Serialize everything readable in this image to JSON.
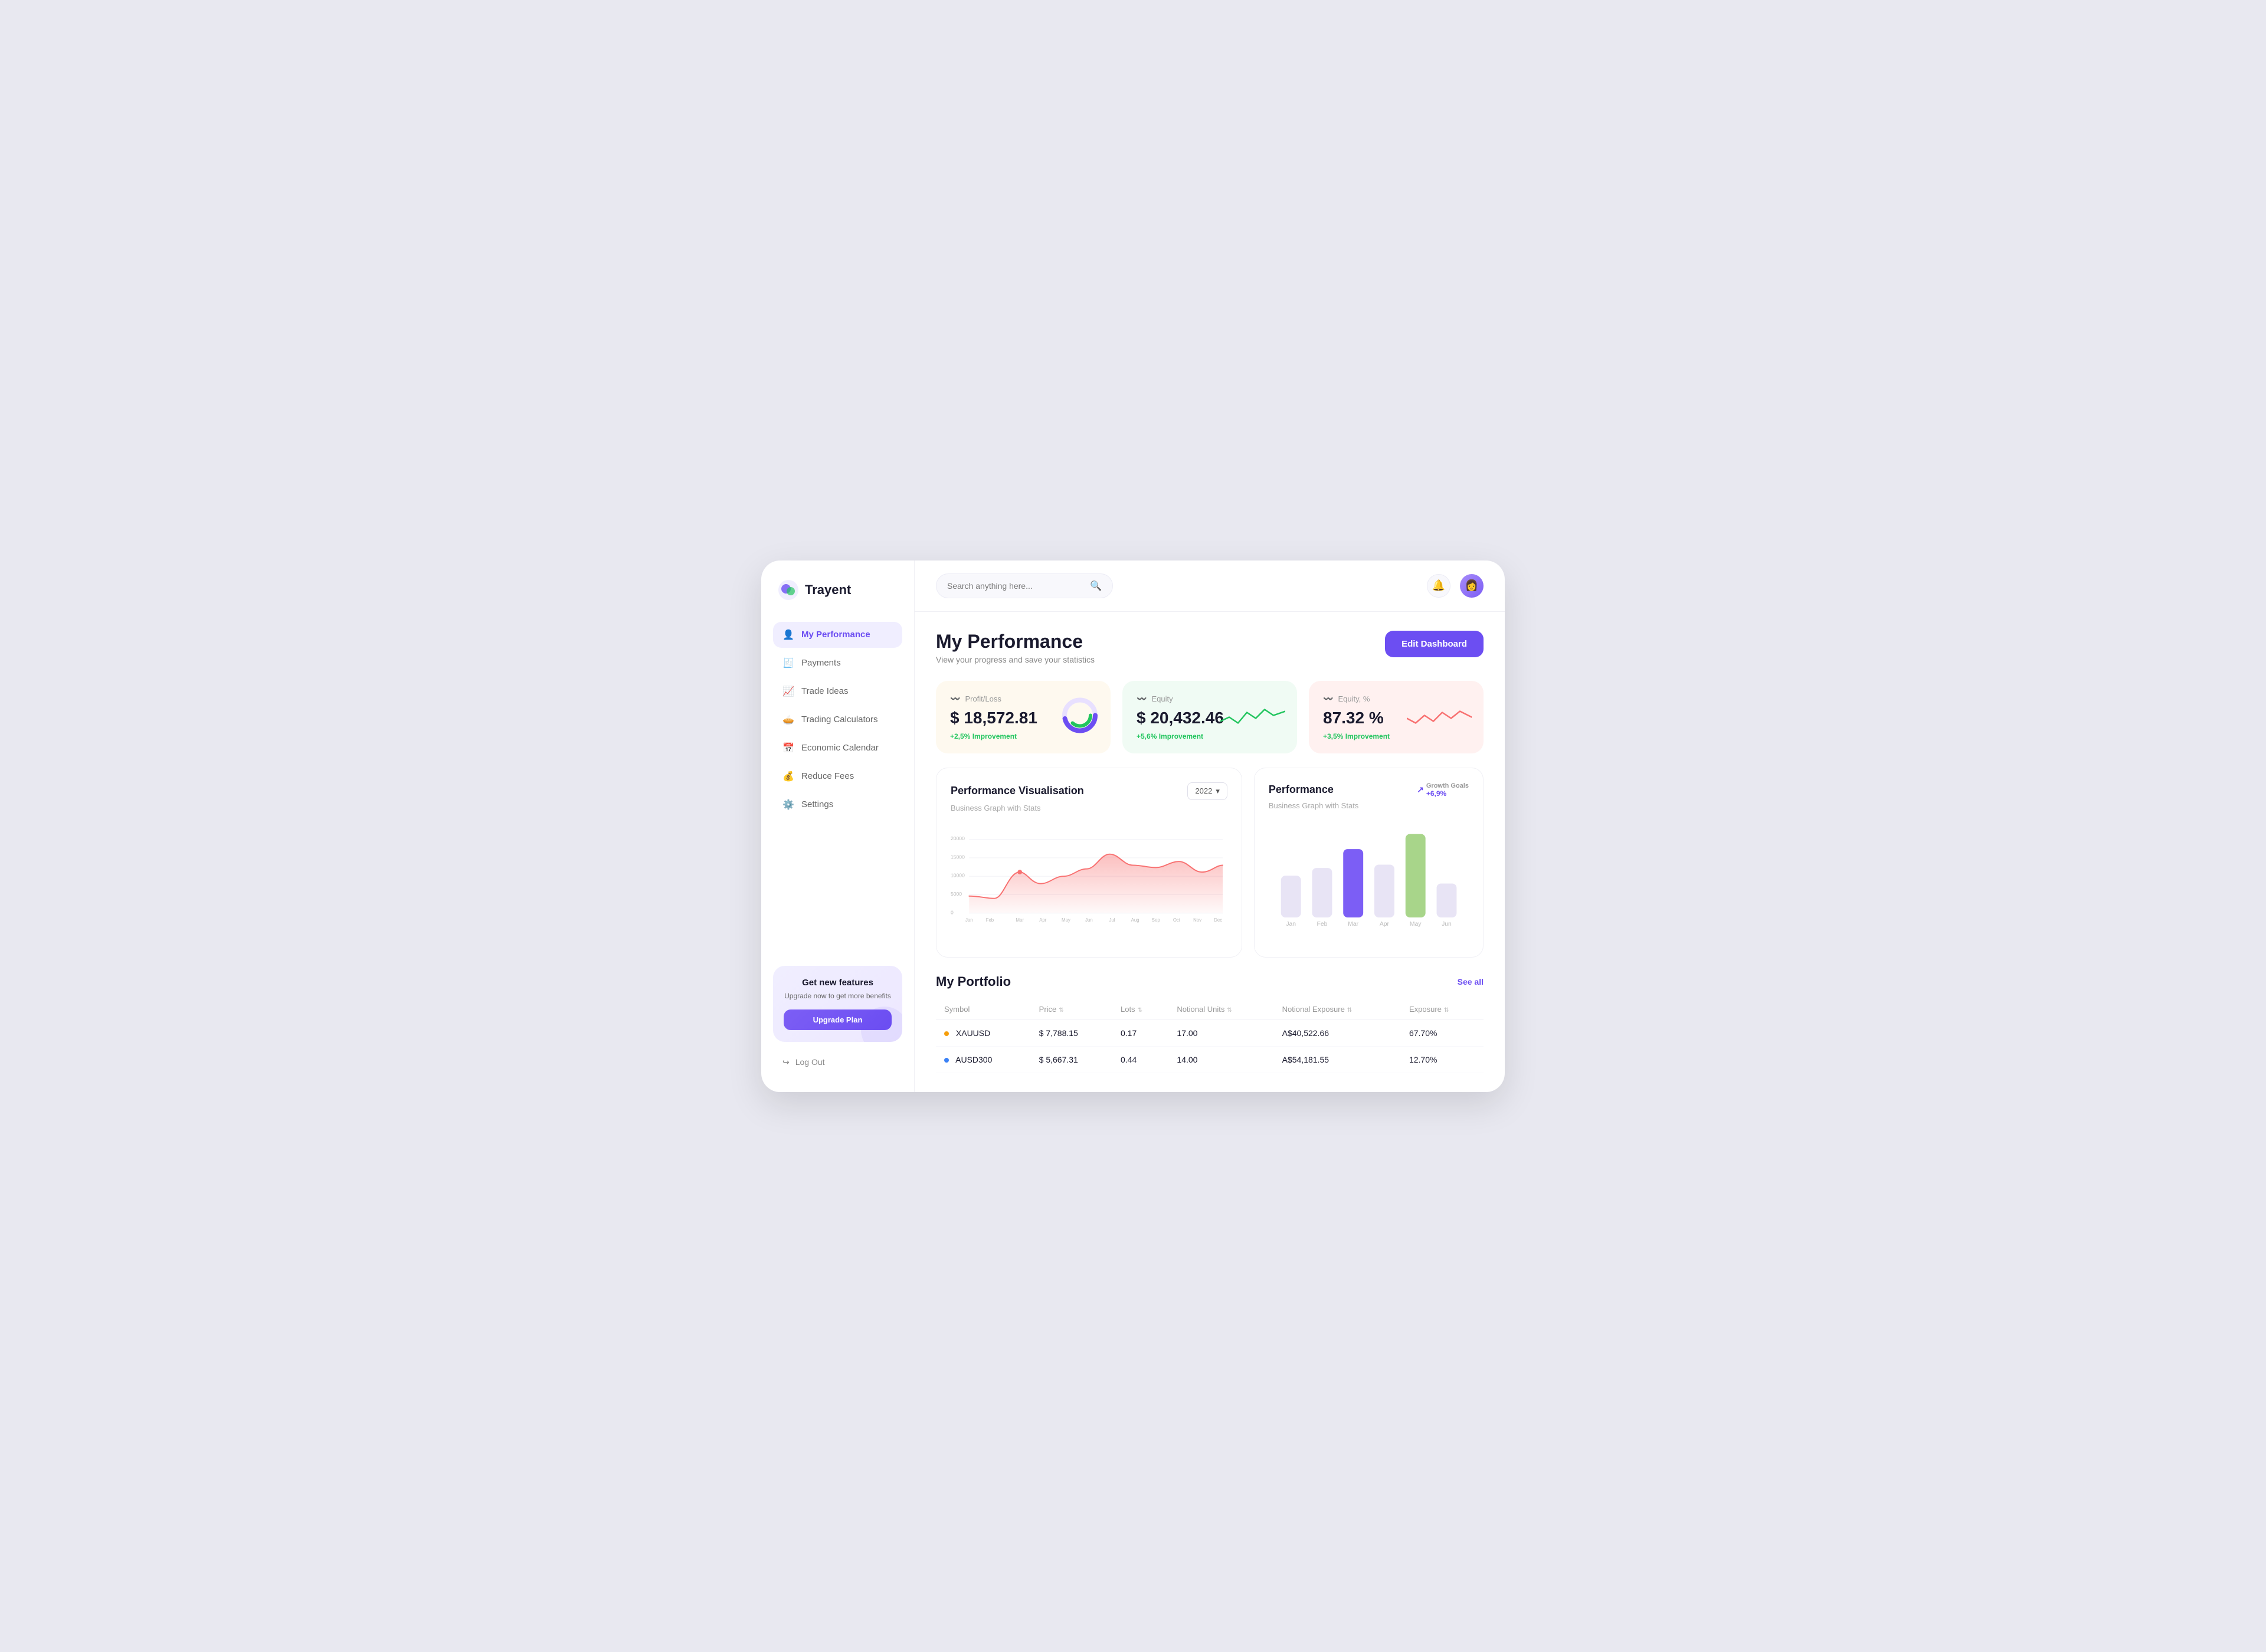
{
  "app": {
    "name": "Trayent"
  },
  "search": {
    "placeholder": "Search anything here..."
  },
  "sidebar": {
    "items": [
      {
        "id": "my-performance",
        "label": "My Performance",
        "icon": "👤",
        "active": true
      },
      {
        "id": "payments",
        "label": "Payments",
        "icon": "🧾",
        "active": false
      },
      {
        "id": "trade-ideas",
        "label": "Trade Ideas",
        "icon": "📈",
        "active": false
      },
      {
        "id": "trading-calculators",
        "label": "Trading Calculators",
        "icon": "🥧",
        "active": false
      },
      {
        "id": "economic-calendar",
        "label": "Economic Calendar",
        "icon": "📅",
        "active": false
      },
      {
        "id": "reduce-fees",
        "label": "Reduce Fees",
        "icon": "💰",
        "active": false
      },
      {
        "id": "settings",
        "label": "Settings",
        "icon": "⚙️",
        "active": false
      }
    ],
    "upgrade": {
      "title": "Get new features",
      "description": "Upgrade now to get more benefits",
      "button_label": "Upgrade Plan"
    },
    "logout": "Log Out"
  },
  "header": {
    "title": "My Performance",
    "subtitle": "View your progress and save your statistics",
    "edit_button": "Edit Dashboard"
  },
  "metrics": [
    {
      "label": "Profit/Loss",
      "value": "$ 18,572.81",
      "change": "+2,5%",
      "change_label": "Improvement",
      "type": "donut",
      "theme": "cream",
      "donut_pct": 72
    },
    {
      "label": "Equity",
      "value": "$ 20,432.46",
      "change": "+5,6%",
      "change_label": "Improvement",
      "type": "line-green",
      "theme": "green"
    },
    {
      "label": "Equity, %",
      "value": "87.32 %",
      "change": "+3,5%",
      "change_label": "Improvement",
      "type": "line-pink",
      "theme": "pink"
    }
  ],
  "performance_chart": {
    "title": "Performance Visualisation",
    "subtitle": "Business Graph with Stats",
    "year": "2022",
    "months": [
      "Jan",
      "Feb",
      "Mar",
      "Apr",
      "May",
      "Jun",
      "Jul",
      "Aug",
      "Sep",
      "Oct",
      "Nov",
      "Dec"
    ],
    "values": [
      5000,
      4500,
      11000,
      8000,
      10000,
      12000,
      16000,
      13000,
      12500,
      14000,
      11000,
      13000
    ],
    "y_labels": [
      "20000",
      "15000",
      "10000",
      "5000",
      "0"
    ]
  },
  "bar_chart": {
    "title": "Performance",
    "subtitle": "Business Graph with Stats",
    "growth_label": "Growth Goals",
    "growth_value": "+6,9%",
    "months": [
      "Jan",
      "Feb",
      "Mar",
      "Apr",
      "May",
      "Jun"
    ],
    "bars": [
      {
        "label": "Jan",
        "value": 55,
        "color": "#e8e4f5"
      },
      {
        "label": "Feb",
        "value": 65,
        "color": "#e8e4f5"
      },
      {
        "label": "Mar",
        "value": 90,
        "color": "#7c5ef5"
      },
      {
        "label": "Apr",
        "value": 70,
        "color": "#e8e4f5"
      },
      {
        "label": "May",
        "value": 110,
        "color": "#a8d58a"
      },
      {
        "label": "Jun",
        "value": 45,
        "color": "#e8e4f5"
      }
    ]
  },
  "portfolio": {
    "title": "My Portfolio",
    "see_all": "See all",
    "columns": [
      "Symbol",
      "Price",
      "Lots",
      "Notional Units",
      "Notional Exposure",
      "Exposure"
    ],
    "rows": [
      {
        "symbol": "XAUUSD",
        "color": "gold",
        "price": "$ 7,788.15",
        "lots": "0.17",
        "notional_units": "17.00",
        "notional_exposure": "A$40,522.66",
        "exposure": "67.70%"
      },
      {
        "symbol": "AUSD300",
        "color": "blue",
        "price": "$ 5,667.31",
        "lots": "0.44",
        "notional_units": "14.00",
        "notional_exposure": "A$54,181.55",
        "exposure": "12.70%"
      }
    ]
  }
}
